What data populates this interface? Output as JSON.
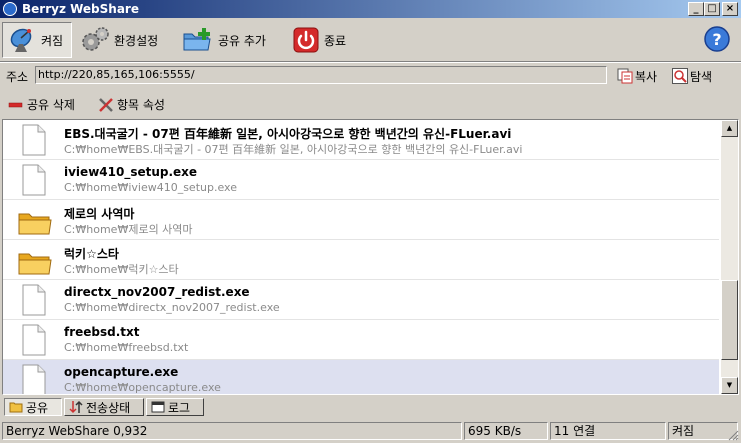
{
  "window": {
    "title": "Berryz WebShare",
    "controls": [
      "_",
      "□",
      "×"
    ]
  },
  "toolbar": {
    "power_label": "켜짐",
    "settings_label": "환경설정",
    "add_share_label": "공유 추가",
    "exit_label": "종료"
  },
  "address": {
    "label": "주소",
    "value": "http://220,85,165,106:5555/",
    "copy_label": "복사",
    "browse_label": "탐색"
  },
  "actions": {
    "delete_share_label": "공유 삭제",
    "properties_label": "항목 속성"
  },
  "items": [
    {
      "name": "EBS.대국굴기 - 07편 百年維新 일본, 아시아강국으로 향한 백년간의 유신-FLuer.avi",
      "path": "C:₩home₩EBS.대국굴기 - 07편 百年維新 일본, 아시아강국으로 향한 백년간의 유신-FLuer.avi",
      "kind": "file-icon"
    },
    {
      "name": "iview410_setup.exe",
      "path": "C:₩home₩iview410_setup.exe",
      "kind": "file-icon"
    },
    {
      "name": "제로의 사역마",
      "path": "C:₩home₩제로의 사역마",
      "kind": "folder-icon"
    },
    {
      "name": "럭키☆스타",
      "path": "C:₩home₩럭키☆스타",
      "kind": "folder-icon"
    },
    {
      "name": "directx_nov2007_redist.exe",
      "path": "C:₩home₩directx_nov2007_redist.exe",
      "kind": "file-icon"
    },
    {
      "name": "freebsd.txt",
      "path": "C:₩home₩freebsd.txt",
      "kind": "file-icon"
    },
    {
      "name": "opencapture.exe",
      "path": "C:₩home₩opencapture.exe",
      "kind": "file-icon"
    }
  ],
  "selected_index": 6,
  "tabs": [
    {
      "label": "공유",
      "selected": true
    },
    {
      "label": "전송상태",
      "selected": false
    },
    {
      "label": "로그",
      "selected": false
    }
  ],
  "statusbar": {
    "app_version": "Berryz WebShare 0,932",
    "speed": "695 KB/s",
    "connections": "11 연결",
    "state": "켜짐"
  },
  "colors": {
    "titlebar_start": "#0a246a",
    "titlebar_end": "#a6caf0",
    "face": "#d4d0c8",
    "selected_row": "#dde0f0",
    "path_text": "#8a8a8a"
  }
}
